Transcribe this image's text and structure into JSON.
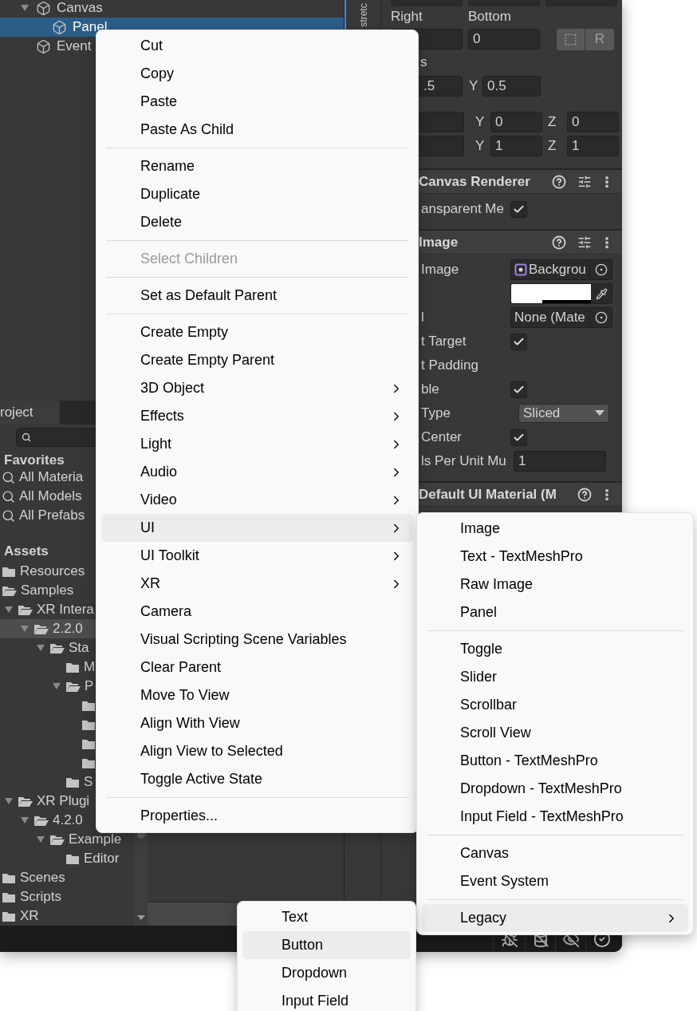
{
  "hierarchy": {
    "items": [
      {
        "label": "Canvas",
        "expanded": true,
        "selected": false,
        "children": [
          {
            "label": "Panel",
            "selected": true
          }
        ]
      },
      {
        "label": "Event",
        "selected": false
      }
    ]
  },
  "inspector": {
    "side_tab": "stretc",
    "anchor": {
      "right_label": "Right",
      "bottom_label": "Bottom",
      "bottom_value": "0",
      "raw_button": "R"
    },
    "pivot": {
      "label": "s",
      "x_value": ".5",
      "y_axis": "Y",
      "y_value": "0.5"
    },
    "rotation": [
      {
        "axis": "Y",
        "value": "0"
      },
      {
        "axis": "Z",
        "value": "0"
      }
    ],
    "scale": [
      {
        "axis": "Y",
        "value": "1"
      },
      {
        "axis": "Z",
        "value": "1"
      }
    ],
    "components": [
      {
        "title": "Canvas Renderer",
        "preset": true,
        "properties": [
          {
            "kind": "checkbox",
            "label": "ansparent Me",
            "checked": true
          }
        ]
      },
      {
        "title": "Image",
        "preset": true,
        "properties": [
          {
            "kind": "object",
            "label": "Image",
            "value": "Backgrou",
            "sprite": true
          },
          {
            "kind": "color"
          },
          {
            "kind": "object",
            "label": "l",
            "value": "None (Mate",
            "sprite": false
          },
          {
            "kind": "checkbox",
            "label": "t Target",
            "checked": true
          },
          {
            "kind": "foldout",
            "label": "t Padding"
          },
          {
            "kind": "checkbox",
            "label": "ble",
            "checked": true
          },
          {
            "kind": "dropdown",
            "label": "Type",
            "value": "Sliced"
          },
          {
            "kind": "checkbox",
            "label": "Center",
            "checked": true
          },
          {
            "kind": "number",
            "label": "ls Per Unit Mu",
            "value": "1"
          }
        ]
      },
      {
        "title": "Default UI Material (M",
        "preset": false
      }
    ]
  },
  "project": {
    "tab": "roject",
    "favorites_title": "Favorites",
    "favorites": [
      "All Materia",
      "All Models",
      "All Prefabs"
    ],
    "assets_title": "Assets",
    "tree": [
      {
        "label": "Resources",
        "open": false,
        "selected": false
      },
      {
        "label": "Samples",
        "open": true,
        "selected": false,
        "children": [
          {
            "label": "XR Intera",
            "expanded": true,
            "open": true,
            "selected": false,
            "children": [
              {
                "label": "2.2.0",
                "expanded": true,
                "open": true,
                "selected": true,
                "children": [
                  {
                    "label": "Sta",
                    "expanded": true,
                    "open": true,
                    "selected": false,
                    "children": [
                      {
                        "label": "M",
                        "open": false,
                        "selected": false
                      },
                      {
                        "label": "P",
                        "expanded": true,
                        "open": true,
                        "selected": false,
                        "children": [
                          {
                            "open": false,
                            "selected": false
                          },
                          {
                            "open": false,
                            "selected": false
                          },
                          {
                            "open": false,
                            "selected": false
                          },
                          {
                            "open": false,
                            "selected": false
                          }
                        ]
                      },
                      {
                        "label": "S",
                        "open": false,
                        "selected": false
                      }
                    ]
                  }
                ]
              }
            ]
          },
          {
            "label": "XR Plugi",
            "expanded": true,
            "open": true,
            "selected": false,
            "children": [
              {
                "label": "4.2.0",
                "expanded": true,
                "open": true,
                "selected": false,
                "children": [
                  {
                    "label": "Example",
                    "expanded": true,
                    "open": true,
                    "selected": false,
                    "children": [
                      {
                        "label": "Editor",
                        "open": false,
                        "selected": false
                      }
                    ]
                  }
                ]
              }
            ]
          }
        ]
      },
      {
        "label": "Scenes",
        "open": false,
        "selected": false
      },
      {
        "label": "Scripts",
        "open": false,
        "selected": false
      },
      {
        "label": "XR",
        "open": false,
        "selected": false
      }
    ]
  },
  "context_menu": {
    "groups": [
      [
        {
          "label": "Cut",
          "disabled": false,
          "submenu": false,
          "highlighted": false
        },
        {
          "label": "Copy",
          "disabled": false,
          "submenu": false,
          "highlighted": false
        },
        {
          "label": "Paste",
          "disabled": false,
          "submenu": false,
          "highlighted": false
        },
        {
          "label": "Paste As Child",
          "disabled": false,
          "submenu": false,
          "highlighted": false
        }
      ],
      [
        {
          "label": "Rename",
          "disabled": false,
          "submenu": false,
          "highlighted": false
        },
        {
          "label": "Duplicate",
          "disabled": false,
          "submenu": false,
          "highlighted": false
        },
        {
          "label": "Delete",
          "disabled": false,
          "submenu": false,
          "highlighted": false
        }
      ],
      [
        {
          "label": "Select Children",
          "disabled": true,
          "submenu": false,
          "highlighted": false
        }
      ],
      [
        {
          "label": "Set as Default Parent",
          "disabled": false,
          "submenu": false,
          "highlighted": false
        }
      ],
      [
        {
          "label": "Create Empty",
          "disabled": false,
          "submenu": false,
          "highlighted": false
        },
        {
          "label": "Create Empty Parent",
          "disabled": false,
          "submenu": false,
          "highlighted": false
        },
        {
          "label": "3D Object",
          "disabled": false,
          "submenu": true,
          "highlighted": false
        },
        {
          "label": "Effects",
          "disabled": false,
          "submenu": true,
          "highlighted": false
        },
        {
          "label": "Light",
          "disabled": false,
          "submenu": true,
          "highlighted": false
        },
        {
          "label": "Audio",
          "disabled": false,
          "submenu": true,
          "highlighted": false
        },
        {
          "label": "Video",
          "disabled": false,
          "submenu": true,
          "highlighted": false
        },
        {
          "label": "UI",
          "disabled": false,
          "submenu": true,
          "highlighted": true
        },
        {
          "label": "UI Toolkit",
          "disabled": false,
          "submenu": true,
          "highlighted": false
        },
        {
          "label": "XR",
          "disabled": false,
          "submenu": true,
          "highlighted": false
        },
        {
          "label": "Camera",
          "disabled": false,
          "submenu": false,
          "highlighted": false
        },
        {
          "label": "Visual Scripting Scene Variables",
          "disabled": false,
          "submenu": false,
          "highlighted": false
        },
        {
          "label": "Clear Parent",
          "disabled": false,
          "submenu": false,
          "highlighted": false
        },
        {
          "label": "Move To View",
          "disabled": false,
          "submenu": false,
          "highlighted": false
        },
        {
          "label": "Align With View",
          "disabled": false,
          "submenu": false,
          "highlighted": false
        },
        {
          "label": "Align View to Selected",
          "disabled": false,
          "submenu": false,
          "highlighted": false
        },
        {
          "label": "Toggle Active State",
          "disabled": false,
          "submenu": false,
          "highlighted": false
        }
      ],
      [
        {
          "label": "Properties...",
          "disabled": false,
          "submenu": false,
          "highlighted": false
        }
      ]
    ]
  },
  "ui_submenu": {
    "groups": [
      [
        {
          "label": "Image",
          "disabled": false,
          "submenu": false,
          "highlighted": false
        },
        {
          "label": "Text - TextMeshPro",
          "disabled": false,
          "submenu": false,
          "highlighted": false
        },
        {
          "label": "Raw Image",
          "disabled": false,
          "submenu": false,
          "highlighted": false
        },
        {
          "label": "Panel",
          "disabled": false,
          "submenu": false,
          "highlighted": false
        }
      ],
      [
        {
          "label": "Toggle",
          "disabled": false,
          "submenu": false,
          "highlighted": false
        },
        {
          "label": "Slider",
          "disabled": false,
          "submenu": false,
          "highlighted": false
        },
        {
          "label": "Scrollbar",
          "disabled": false,
          "submenu": false,
          "highlighted": false
        },
        {
          "label": "Scroll View",
          "disabled": false,
          "submenu": false,
          "highlighted": false
        },
        {
          "label": "Button - TextMeshPro",
          "disabled": false,
          "submenu": false,
          "highlighted": false
        },
        {
          "label": "Dropdown - TextMeshPro",
          "disabled": false,
          "submenu": false,
          "highlighted": false
        },
        {
          "label": "Input Field - TextMeshPro",
          "disabled": false,
          "submenu": false,
          "highlighted": false
        }
      ],
      [
        {
          "label": "Canvas",
          "disabled": false,
          "submenu": false,
          "highlighted": false
        },
        {
          "label": "Event System",
          "disabled": false,
          "submenu": false,
          "highlighted": false
        }
      ],
      [
        {
          "label": "Legacy",
          "disabled": false,
          "submenu": true,
          "highlighted": true
        }
      ]
    ]
  },
  "legacy_submenu": {
    "groups": [
      [
        {
          "label": "Text",
          "disabled": false,
          "submenu": false,
          "highlighted": false
        },
        {
          "label": "Button",
          "disabled": false,
          "submenu": false,
          "highlighted": true
        },
        {
          "label": "Dropdown",
          "disabled": false,
          "submenu": false,
          "highlighted": false
        },
        {
          "label": "Input Field",
          "disabled": false,
          "submenu": false,
          "highlighted": false
        }
      ]
    ]
  }
}
